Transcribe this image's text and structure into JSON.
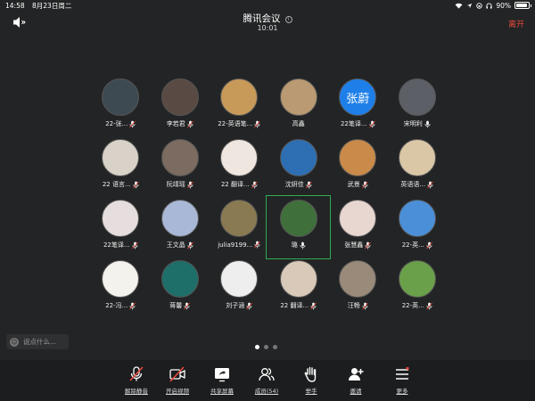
{
  "status_bar": {
    "time": "14:58",
    "date": "8月23日周二",
    "battery": "90%",
    "battery_level": 0.9
  },
  "header": {
    "title": "腾讯会议",
    "time": "10:01",
    "leave_label": "离开"
  },
  "participants": [
    {
      "name": "22-张...",
      "color": "#3d4a52",
      "avatar_text": "",
      "mic": "muted"
    },
    {
      "name": "李若君",
      "color": "#5a4a44",
      "avatar_text": "",
      "mic": "muted"
    },
    {
      "name": "22-英语笔...",
      "color": "#c79a5a",
      "avatar_text": "",
      "mic": "muted"
    },
    {
      "name": "高鑫",
      "color": "#b99a72",
      "avatar_text": "",
      "mic": "none"
    },
    {
      "name": "22笔译...",
      "color": "#1f7fe8",
      "avatar_text": "张蔚",
      "mic": "muted"
    },
    {
      "name": "宋明利",
      "color": "#5c5f66",
      "avatar_text": "",
      "mic": "on"
    },
    {
      "name": "22 语言...",
      "color": "#d8d2c8",
      "avatar_text": "",
      "mic": "muted"
    },
    {
      "name": "阮靖瑶",
      "color": "#7b6b60",
      "avatar_text": "",
      "mic": "muted"
    },
    {
      "name": "22 翻译...",
      "color": "#f0e6e0",
      "avatar_text": "",
      "mic": "muted"
    },
    {
      "name": "沈妍佳",
      "color": "#2e6fb3",
      "avatar_text": "",
      "mic": "muted"
    },
    {
      "name": "武景",
      "color": "#c98a4a",
      "avatar_text": "",
      "mic": "muted"
    },
    {
      "name": "英语语...",
      "color": "#d9c7a6",
      "avatar_text": "",
      "mic": "muted"
    },
    {
      "name": "22笔译...",
      "color": "#e6dede",
      "avatar_text": "",
      "mic": "muted"
    },
    {
      "name": "王文晶",
      "color": "#a9b8d6",
      "avatar_text": "",
      "mic": "muted"
    },
    {
      "name": "julia9199...",
      "color": "#8a7a52",
      "avatar_text": "",
      "mic": "muted"
    },
    {
      "name": "璐",
      "color": "#3f6f3a",
      "avatar_text": "",
      "mic": "on"
    },
    {
      "name": "张慧鑫",
      "color": "#e8d6d0",
      "avatar_text": "",
      "mic": "muted"
    },
    {
      "name": "22-英...",
      "color": "#4a8fd8",
      "avatar_text": "",
      "mic": "muted"
    },
    {
      "name": "22-冯...",
      "color": "#f4f2ec",
      "avatar_text": "",
      "mic": "muted"
    },
    {
      "name": "蒋馨",
      "color": "#1e6e6a",
      "avatar_text": "",
      "mic": "muted"
    },
    {
      "name": "刘子涵",
      "color": "#eeeeee",
      "avatar_text": "",
      "mic": "muted"
    },
    {
      "name": "22 翻译...",
      "color": "#d8c9b8",
      "avatar_text": "",
      "mic": "muted"
    },
    {
      "name": "汪畅",
      "color": "#9a8a7a",
      "avatar_text": "",
      "mic": "muted"
    },
    {
      "name": "22-英...",
      "color": "#6aa04a",
      "avatar_text": "",
      "mic": "muted"
    }
  ],
  "chat": {
    "placeholder": "说点什么..."
  },
  "pagination": {
    "pages": 3,
    "current": 1
  },
  "toolbar": {
    "unmute": "解除静音",
    "video": "开启视频",
    "share": "共享屏幕",
    "members": "成员(54)",
    "raise_hand": "举手",
    "invite": "邀请",
    "more": "更多"
  },
  "colors": {
    "background": "#232425",
    "leave": "#e8483d",
    "active_speaker": "#2ead55",
    "muted_icon": "#e8483d"
  }
}
